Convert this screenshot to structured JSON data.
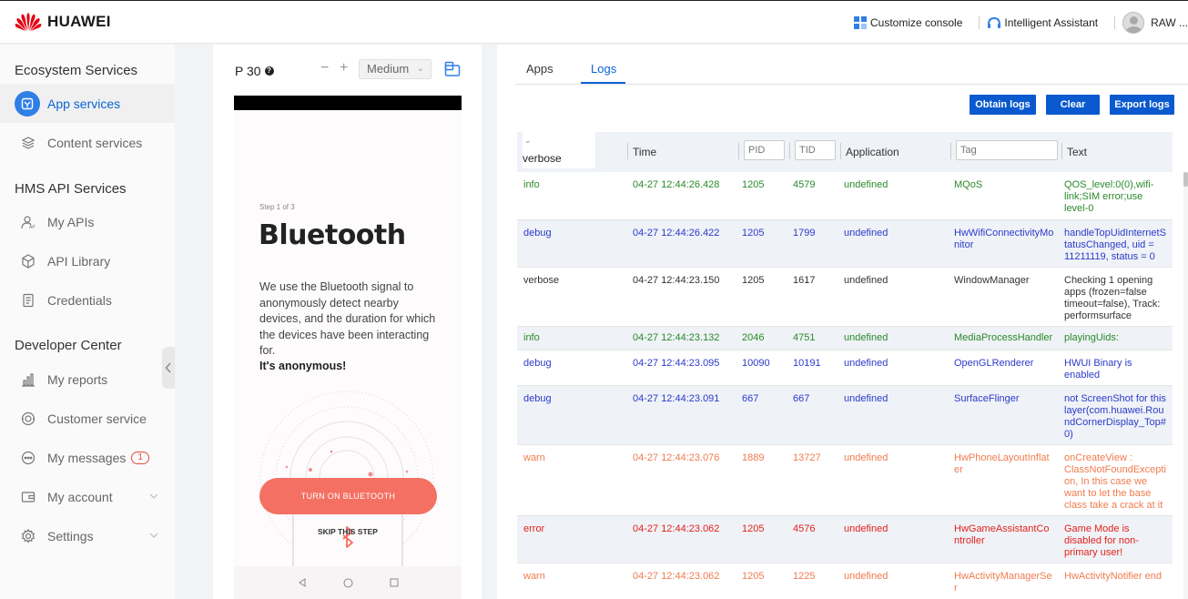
{
  "header": {
    "brand": "HUAWEI",
    "customize": "Customize console",
    "assistant": "Intelligent Assistant",
    "user": "RAW ..."
  },
  "sidebar": {
    "sections": [
      {
        "title": "Ecosystem Services"
      },
      {
        "title": "HMS API Services"
      },
      {
        "title": "Developer Center"
      }
    ],
    "items": [
      {
        "label": "App services",
        "icon": "app-services-icon",
        "active": true
      },
      {
        "label": "Content services",
        "icon": "layers-icon"
      },
      {
        "label": "My APIs",
        "icon": "api-user-icon"
      },
      {
        "label": "API Library",
        "icon": "cube-icon"
      },
      {
        "label": "Credentials",
        "icon": "document-icon"
      },
      {
        "label": "My reports",
        "icon": "bar-chart-icon"
      },
      {
        "label": "Customer service",
        "icon": "headset-icon"
      },
      {
        "label": "My messages",
        "icon": "chat-icon",
        "badge": "1"
      },
      {
        "label": "My account",
        "icon": "wallet-icon"
      },
      {
        "label": "Settings",
        "icon": "gear-icon"
      }
    ]
  },
  "device": {
    "model": "P 30",
    "zoom_out": "−",
    "zoom_in": "+",
    "zoom": "Medium",
    "screen": {
      "step": "Step 1 of 3",
      "title": "Bluetooth",
      "description": "We use the Bluetooth signal to anonymously detect nearby devices, and the duration for which the devices have been interacting for.",
      "emphasis": "It's anonymous!",
      "primary_button": "TURN ON BLUETOOTH",
      "skip": "SKIP THIS STEP"
    }
  },
  "logs": {
    "tabs": [
      "Apps",
      "Logs"
    ],
    "active_tab": "Logs",
    "buttons": {
      "obtain": "Obtain logs",
      "clear": "Clear",
      "export": "Export logs"
    },
    "columns": {
      "level_value": "verbose",
      "time": "Time",
      "pid_placeholder": "PID",
      "tid_placeholder": "TID",
      "application": "Application",
      "tag_placeholder": "Tag",
      "text": "Text"
    },
    "rows": [
      {
        "level": "info",
        "time": "04-27 12:44:26.428",
        "pid": "1205",
        "tid": "4579",
        "app": "undefined",
        "tag": "MQoS",
        "text": "QOS_level:0(0),wifi-link;SIM error;use level-0"
      },
      {
        "level": "debug",
        "time": "04-27 12:44:26.422",
        "pid": "1205",
        "tid": "1799",
        "app": "undefined",
        "tag": "HwWifiConnectivityMonitor",
        "text": "handleTopUidInternetStatusChanged, uid = 11211119, status = 0"
      },
      {
        "level": "verbose",
        "time": "04-27 12:44:23.150",
        "pid": "1205",
        "tid": "1617",
        "app": "undefined",
        "tag": "WindowManager",
        "text": "Checking 1 opening apps (frozen=false timeout=false), Track: performsurface"
      },
      {
        "level": "info",
        "time": "04-27 12:44:23.132",
        "pid": "2046",
        "tid": "4751",
        "app": "undefined",
        "tag": "MediaProcessHandler",
        "text": "playingUids:"
      },
      {
        "level": "debug",
        "time": "04-27 12:44:23.095",
        "pid": "10090",
        "tid": "10191",
        "app": "undefined",
        "tag": "OpenGLRenderer",
        "text": "HWUI Binary is enabled"
      },
      {
        "level": "debug",
        "time": "04-27 12:44:23.091",
        "pid": "667",
        "tid": "667",
        "app": "undefined",
        "tag": "SurfaceFlinger",
        "text": "not ScreenShot for this layer(com.huawei.RoundCornerDisplay_Top#0)"
      },
      {
        "level": "warn",
        "time": "04-27 12:44:23.076",
        "pid": "1889",
        "tid": "13727",
        "app": "undefined",
        "tag": "HwPhoneLayoutInflater",
        "text": "onCreateView : ClassNotFoundException, In this case we want to let the base class take a crack at it"
      },
      {
        "level": "error",
        "time": "04-27 12:44:23.062",
        "pid": "1205",
        "tid": "4576",
        "app": "undefined",
        "tag": "HwGameAssistantController",
        "text": "Game Mode is disabled for non-primary user!"
      },
      {
        "level": "warn",
        "time": "04-27 12:44:23.062",
        "pid": "1205",
        "tid": "1225",
        "app": "undefined",
        "tag": "HwActivityManagerSer",
        "text": "HwActivityNotifier end"
      }
    ]
  }
}
